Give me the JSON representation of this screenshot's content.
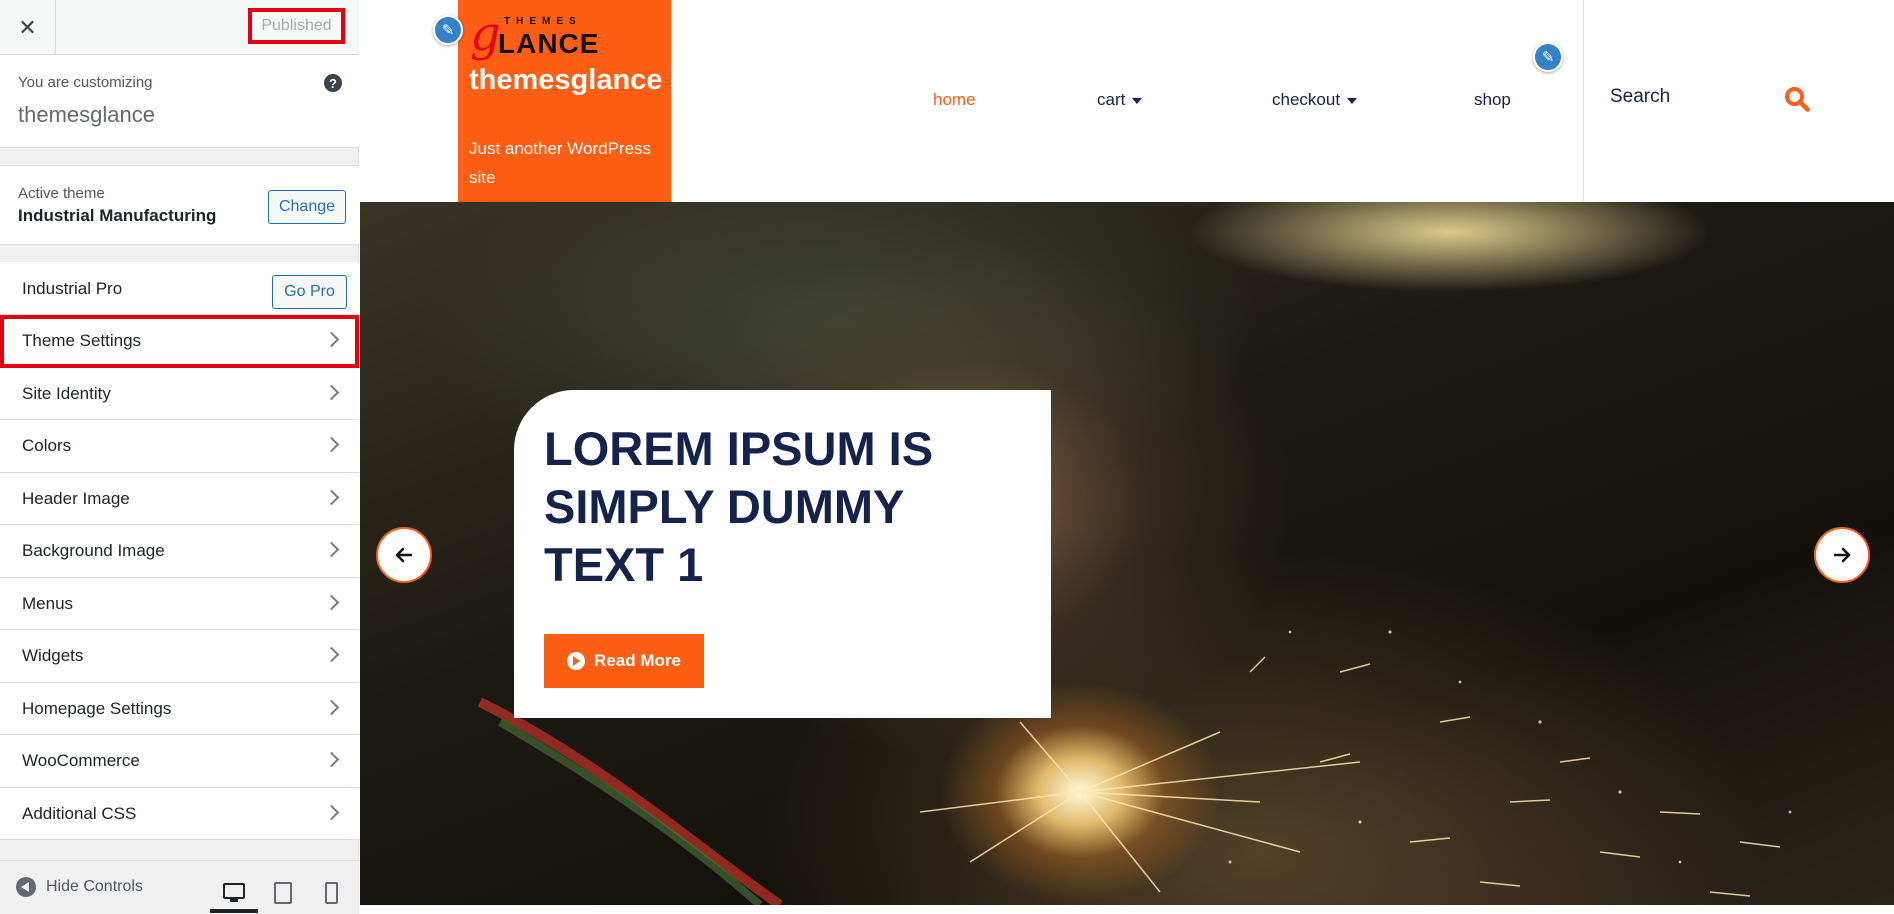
{
  "sidebar": {
    "published_label": "Published",
    "customizing_label": "You are customizing",
    "site_name": "themesglance",
    "help_icon": "?",
    "active_theme_label": "Active theme",
    "active_theme_name": "Industrial Manufacturing",
    "change_label": "Change",
    "pro_label": "Industrial Pro",
    "go_pro_label": "Go Pro",
    "panels": [
      {
        "label": "Theme Settings",
        "highlighted": true
      },
      {
        "label": "Site Identity"
      },
      {
        "label": "Colors"
      },
      {
        "label": "Header Image"
      },
      {
        "label": "Background Image"
      },
      {
        "label": "Menus"
      },
      {
        "label": "Widgets"
      },
      {
        "label": "Homepage Settings"
      },
      {
        "label": "WooCommerce"
      },
      {
        "label": "Additional CSS"
      }
    ],
    "hide_controls_label": "Hide Controls",
    "devices": [
      "desktop-icon",
      "tablet-icon",
      "mobile-icon"
    ],
    "active_device": "desktop"
  },
  "preview": {
    "logo": {
      "letter": "g",
      "top_text": "THEMES",
      "bottom_text": "LANCE"
    },
    "site_title": "themesglance",
    "site_description": "Just another WordPress site",
    "nav": [
      {
        "label": "home",
        "active": true,
        "dropdown": false
      },
      {
        "label": "cart",
        "active": false,
        "dropdown": true
      },
      {
        "label": "checkout",
        "active": false,
        "dropdown": true
      },
      {
        "label": "shop",
        "active": false,
        "dropdown": false
      }
    ],
    "search_placeholder": "Search",
    "slide": {
      "title": "LOREM IPSUM IS SIMPLY DUMMY TEXT 1",
      "button_label": "Read More"
    }
  },
  "colors": {
    "accent": "#ff5e14",
    "navy": "#14234b",
    "highlight": "#e6000f",
    "wp_blue": "#2271b1"
  }
}
